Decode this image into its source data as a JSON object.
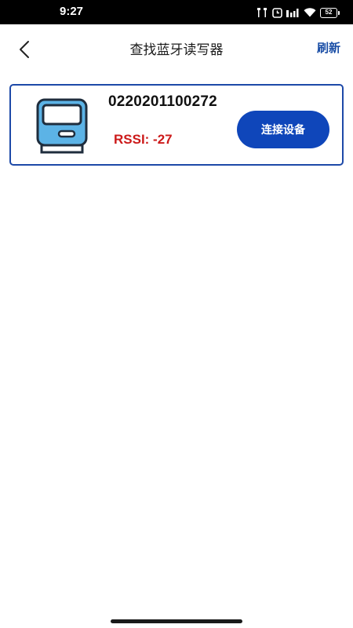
{
  "status_bar": {
    "time": "9:27",
    "battery": "52",
    "icons": [
      "earbuds-icon",
      "alarm-icon",
      "cell-signal-icon",
      "wifi-icon",
      "battery-icon"
    ]
  },
  "header": {
    "back_icon": "chevron-left-icon",
    "title": "查找蓝牙读写器",
    "refresh_label": "刷新"
  },
  "devices": [
    {
      "id": "0220201100272",
      "rssi_text": "RSSI: -27",
      "connect_label": "连接设备",
      "icon": "card-reader-icon"
    }
  ],
  "colors": {
    "accent": "#1a4ea6",
    "button": "#0f46ba",
    "card_border": "#1d49a8",
    "rssi": "#cc1a1a",
    "reader_body": "#5cb3e6"
  }
}
